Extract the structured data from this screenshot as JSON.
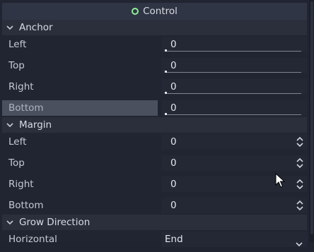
{
  "class_header": {
    "title": "Control",
    "icon": "control-node-icon",
    "icon_color": "#8eef97"
  },
  "anchor": {
    "section_title": "Anchor",
    "rows": [
      {
        "label": "Left",
        "value": "0"
      },
      {
        "label": "Top",
        "value": "0"
      },
      {
        "label": "Right",
        "value": "0"
      },
      {
        "label": "Bottom",
        "value": "0"
      }
    ]
  },
  "margin": {
    "section_title": "Margin",
    "rows": [
      {
        "label": "Left",
        "value": "0"
      },
      {
        "label": "Top",
        "value": "0"
      },
      {
        "label": "Right",
        "value": "0"
      },
      {
        "label": "Bottom",
        "value": "0"
      }
    ]
  },
  "grow_direction": {
    "section_title": "Grow Direction",
    "rows": [
      {
        "label": "Horizontal",
        "value": "End"
      }
    ]
  }
}
